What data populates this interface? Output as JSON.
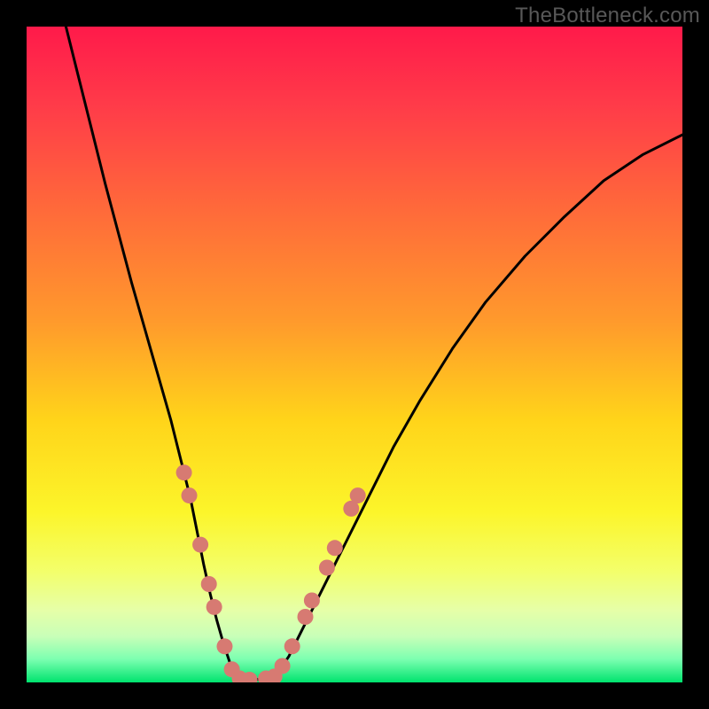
{
  "watermark": "TheBottleneck.com",
  "chart_data": {
    "type": "line",
    "title": "",
    "xlabel": "",
    "ylabel": "",
    "xlim": [
      0,
      100
    ],
    "ylim": [
      0,
      100
    ],
    "grid": false,
    "legend": false,
    "background_gradient_stops": [
      {
        "offset": 0.0,
        "color": "#ff1a4a"
      },
      {
        "offset": 0.12,
        "color": "#ff3b49"
      },
      {
        "offset": 0.28,
        "color": "#ff6a3a"
      },
      {
        "offset": 0.45,
        "color": "#ff9a2c"
      },
      {
        "offset": 0.6,
        "color": "#ffd41a"
      },
      {
        "offset": 0.74,
        "color": "#fcf52a"
      },
      {
        "offset": 0.83,
        "color": "#f3ff6a"
      },
      {
        "offset": 0.89,
        "color": "#e6ffa8"
      },
      {
        "offset": 0.93,
        "color": "#c8ffb8"
      },
      {
        "offset": 0.965,
        "color": "#7bffb0"
      },
      {
        "offset": 1.0,
        "color": "#00e36e"
      }
    ],
    "series": [
      {
        "name": "left-branch",
        "type": "line",
        "color": "#000000",
        "x": [
          6,
          8,
          10,
          12,
          14,
          16,
          18,
          20,
          22,
          23.5,
          25,
          26,
          27,
          28,
          29,
          30,
          31,
          32
        ],
        "y": [
          100,
          92,
          84,
          76,
          68.5,
          61,
          54,
          47,
          40,
          34,
          28,
          23,
          18,
          13.5,
          9.5,
          6,
          3,
          0.8
        ]
      },
      {
        "name": "valley-floor",
        "type": "line",
        "color": "#000000",
        "x": [
          32,
          34,
          36,
          38
        ],
        "y": [
          0.8,
          0.4,
          0.5,
          1.0
        ]
      },
      {
        "name": "right-branch",
        "type": "line",
        "color": "#000000",
        "x": [
          38,
          40,
          42,
          45,
          48,
          52,
          56,
          60,
          65,
          70,
          76,
          82,
          88,
          94,
          100
        ],
        "y": [
          1.0,
          4,
          8,
          14,
          20,
          28,
          36,
          43,
          51,
          58,
          65,
          71,
          76.5,
          80.5,
          83.5
        ]
      }
    ],
    "markers": [
      {
        "name": "left-branch-dots",
        "color": "#d77a72",
        "radius": 9,
        "points": [
          {
            "x": 24.0,
            "y": 32.0
          },
          {
            "x": 24.8,
            "y": 28.5
          },
          {
            "x": 26.5,
            "y": 21.0
          },
          {
            "x": 27.8,
            "y": 15.0
          },
          {
            "x": 28.6,
            "y": 11.5
          },
          {
            "x": 30.2,
            "y": 5.5
          },
          {
            "x": 31.3,
            "y": 2.0
          }
        ]
      },
      {
        "name": "valley-dots",
        "color": "#d77a72",
        "radius": 9,
        "points": [
          {
            "x": 32.5,
            "y": 0.6
          },
          {
            "x": 34.0,
            "y": 0.4
          },
          {
            "x": 36.5,
            "y": 0.6
          },
          {
            "x": 37.8,
            "y": 0.9
          }
        ]
      },
      {
        "name": "right-branch-dots",
        "color": "#d77a72",
        "radius": 9,
        "points": [
          {
            "x": 39.0,
            "y": 2.5
          },
          {
            "x": 40.5,
            "y": 5.5
          },
          {
            "x": 42.5,
            "y": 10.0
          },
          {
            "x": 43.5,
            "y": 12.5
          },
          {
            "x": 45.8,
            "y": 17.5
          },
          {
            "x": 47.0,
            "y": 20.5
          },
          {
            "x": 49.5,
            "y": 26.5
          },
          {
            "x": 50.5,
            "y": 28.5
          }
        ]
      }
    ]
  }
}
